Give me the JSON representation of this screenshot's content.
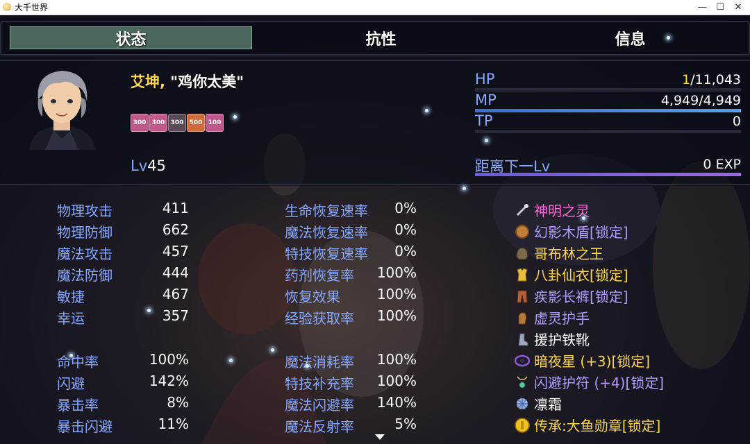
{
  "window": {
    "title": "大千世界",
    "minimize": "—",
    "maximize": "☐",
    "close": "✕"
  },
  "tabs": [
    {
      "label": "状态",
      "active": true
    },
    {
      "label": "抗性",
      "active": false
    },
    {
      "label": "信息",
      "active": false
    }
  ],
  "actor": {
    "name": "艾坤,",
    "nickname": "\"鸡你太美\"",
    "level_label": "Lv",
    "level": "45",
    "states": [
      {
        "text": "300",
        "color": "#c2588a"
      },
      {
        "text": "300",
        "color": "#c2588a"
      },
      {
        "text": "300",
        "color": "#5a4a58"
      },
      {
        "text": "500",
        "color": "#d06a3a"
      },
      {
        "text": "100",
        "color": "#c2588a"
      }
    ]
  },
  "gauges": {
    "hp": {
      "label": "HP",
      "current": "1",
      "max": "/11,043",
      "fill": 0.0001,
      "color": "#d8d8e8"
    },
    "mp": {
      "label": "MP",
      "value": "4,949/4,949",
      "fill": 1.0,
      "color": "#5aa0e8"
    },
    "tp": {
      "label": "TP",
      "value": "0",
      "fill": 0.0,
      "color": "#40a060"
    },
    "exp": {
      "label": "距离下一Lv",
      "value": "0 EXP",
      "fill": 1.0,
      "color": "#9a6ae0"
    }
  },
  "params": [
    {
      "label": "物理攻击",
      "value": "411"
    },
    {
      "label": "物理防御",
      "value": "662"
    },
    {
      "label": "魔法攻击",
      "value": "457"
    },
    {
      "label": "魔法防御",
      "value": "444"
    },
    {
      "label": "敏捷",
      "value": "467"
    },
    {
      "label": "幸运",
      "value": "357"
    }
  ],
  "regen": [
    {
      "label": "生命恢复速率",
      "value": "0%"
    },
    {
      "label": "魔法恢复速率",
      "value": "0%"
    },
    {
      "label": "特技恢复速率",
      "value": "0%"
    },
    {
      "label": "药剂恢复率",
      "value": "100%"
    },
    {
      "label": "恢复效果",
      "value": "100%"
    },
    {
      "label": "经验获取率",
      "value": "100%"
    }
  ],
  "xparams": [
    {
      "label": "命中率",
      "value": "100%"
    },
    {
      "label": "闪避",
      "value": "142%"
    },
    {
      "label": "暴击率",
      "value": "8%"
    },
    {
      "label": "暴击闪避",
      "value": "11%"
    }
  ],
  "sparams": [
    {
      "label": "魔法消耗率",
      "value": "100%"
    },
    {
      "label": "特技补充率",
      "value": "100%"
    },
    {
      "label": "魔法闪避率",
      "value": "140%"
    },
    {
      "label": "魔法反射率",
      "value": "5%"
    }
  ],
  "equipment": [
    {
      "name": "神明之灵",
      "color": "#ff6ad8",
      "icon": "wand-icon"
    },
    {
      "name": "幻影木盾[锁定]",
      "color": "#b49aff",
      "icon": "wood-shield-icon"
    },
    {
      "name": "哥布林之王",
      "color": "#ffd84a",
      "icon": "goblin-helm-icon"
    },
    {
      "name": "八卦仙衣[锁定]",
      "color": "#ffd84a",
      "icon": "robe-icon"
    },
    {
      "name": "疾影长裤[锁定]",
      "color": "#b49aff",
      "icon": "pants-icon"
    },
    {
      "name": "虚灵护手",
      "color": "#b49aff",
      "icon": "gauntlet-icon"
    },
    {
      "name": "援护铁靴",
      "color": "#ffffff",
      "icon": "iron-boots-icon"
    },
    {
      "name": "暗夜星 (+3)[锁定]",
      "color": "#ffd84a",
      "icon": "dark-star-icon"
    },
    {
      "name": "闪避护符 (+4)[锁定]",
      "color": "#b49aff",
      "icon": "amulet-icon"
    },
    {
      "name": "凛霜",
      "color": "#ffffff",
      "icon": "frost-icon"
    },
    {
      "name": "传承:大鱼勋章[锁定]",
      "color": "#ffd84a",
      "icon": "medal-icon"
    }
  ],
  "colors": {
    "system_blue": "#88a8ff",
    "crisis_yellow": "#ffd84a"
  }
}
